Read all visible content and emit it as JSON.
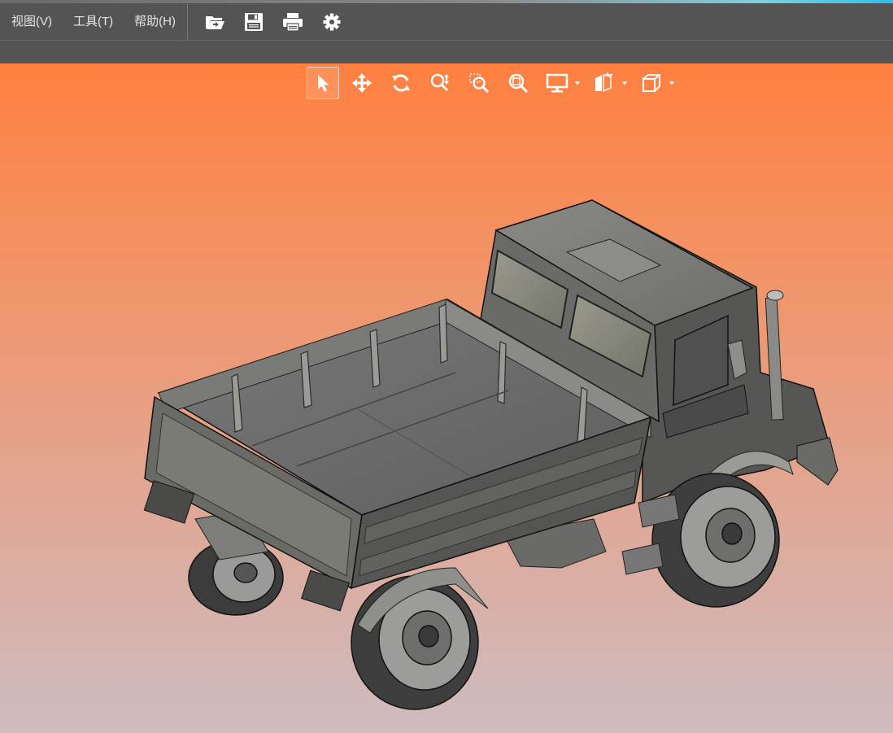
{
  "menubar": {
    "items": [
      {
        "label": "视图(V)"
      },
      {
        "label": "工具(T)"
      },
      {
        "label": "帮助(H)"
      }
    ],
    "tools": [
      {
        "icon": "open-folder-icon"
      },
      {
        "icon": "save-icon"
      },
      {
        "icon": "print-icon"
      },
      {
        "icon": "gear-icon"
      }
    ]
  },
  "view_toolbar": {
    "tools": [
      {
        "icon": "select-arrow-icon",
        "active": true
      },
      {
        "icon": "pan-icon"
      },
      {
        "icon": "rotate-icon"
      },
      {
        "icon": "zoom-icon"
      },
      {
        "icon": "zoom-window-icon"
      },
      {
        "icon": "zoom-fit-icon"
      },
      {
        "icon": "display-mode-icon",
        "dropdown": true
      },
      {
        "icon": "section-view-icon",
        "dropdown": true
      },
      {
        "icon": "view-cube-icon",
        "dropdown": true
      }
    ]
  },
  "viewport": {
    "gradient_top": "#ff8040",
    "gradient_bottom": "#cdbcc0",
    "model": "truck-3d-model"
  },
  "colors": {
    "menubar_bg": "#545454",
    "menu_text": "#e6e6e6",
    "icon_white": "#ffffff"
  }
}
